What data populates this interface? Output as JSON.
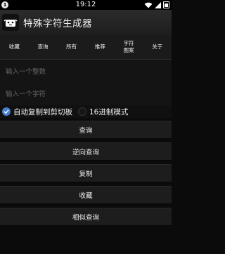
{
  "status_bar": {
    "time": "19:12",
    "notification": "1"
  },
  "app": {
    "title": "特殊字符生成器"
  },
  "tabs": [
    {
      "label": "收藏"
    },
    {
      "label": "查询"
    },
    {
      "label": "所有"
    },
    {
      "label": "推荐"
    },
    {
      "label": "字符\n图案"
    },
    {
      "label": "关于"
    }
  ],
  "inputs": {
    "number_placeholder": "输入一个整数",
    "char_placeholder": "输入一个字符"
  },
  "options": {
    "auto_copy_label": "自动复制到剪切板",
    "auto_copy_checked": true,
    "hex_mode_label": "16进制模式",
    "hex_mode_checked": false
  },
  "buttons": {
    "query": "查询",
    "reverse_query": "逆向查询",
    "copy": "复制",
    "favorite": "收藏",
    "similar_query": "相似查询"
  }
}
